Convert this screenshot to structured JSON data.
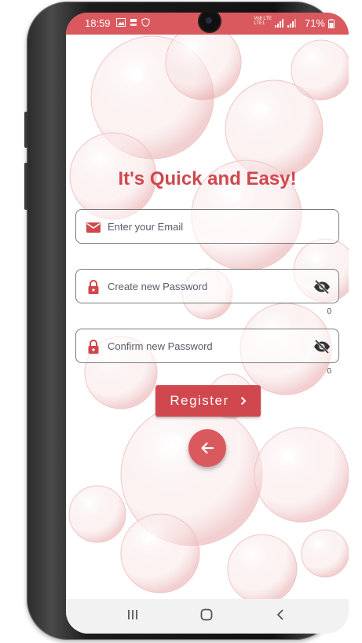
{
  "status_bar": {
    "time": "18:59",
    "network_line1": "Vo8 LTE",
    "network_line2": "LTE1",
    "battery": "71%"
  },
  "colors": {
    "accent": "#d0474d",
    "status_bar": "#d9595e"
  },
  "screen": {
    "title": "It's Quick and Easy!",
    "email": {
      "placeholder": "Enter your Email",
      "icon": "mail-icon"
    },
    "new_password": {
      "placeholder": "Create new Password",
      "icon": "lock-icon",
      "toggle_icon": "eye-off-icon",
      "counter": "0"
    },
    "confirm_password": {
      "placeholder": "Confirm new Password",
      "icon": "lock-icon",
      "toggle_icon": "eye-off-icon",
      "counter": "0"
    },
    "register_label": "Register",
    "register_icon": "chevron-right-icon",
    "back_icon": "arrow-left-icon"
  },
  "nav_bar": {
    "recent_icon": "recent-apps-icon",
    "home_icon": "home-icon",
    "back_icon": "back-icon"
  }
}
